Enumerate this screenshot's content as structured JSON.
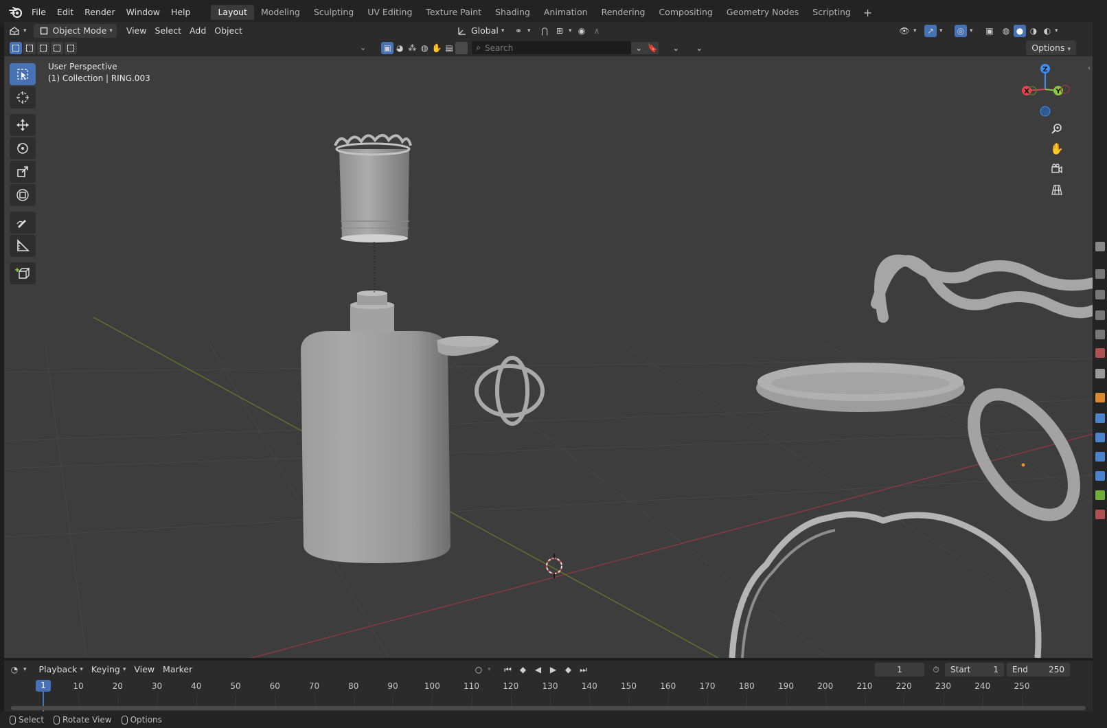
{
  "menu": {
    "items": [
      "File",
      "Edit",
      "Render",
      "Window",
      "Help"
    ]
  },
  "workspaces": {
    "tabs": [
      "Layout",
      "Modeling",
      "Sculpting",
      "UV Editing",
      "Texture Paint",
      "Shading",
      "Animation",
      "Rendering",
      "Compositing",
      "Geometry Nodes",
      "Scripting"
    ],
    "active": "Layout",
    "add_icon": "plus-icon"
  },
  "viewport_header": {
    "mode": "Object Mode",
    "menus": [
      "View",
      "Select",
      "Add",
      "Object"
    ],
    "transform_orientation": "Global"
  },
  "tool_settings": {
    "search_placeholder": "Search",
    "options_label": "Options"
  },
  "viewport": {
    "perspective": "User Perspective",
    "collection_info": "(1) Collection | RING.003",
    "gizmo_axes": [
      "X",
      "Y",
      "Z"
    ],
    "axis_colors": {
      "x": "#e8434f",
      "y": "#8cc63e",
      "z": "#3f8ef0"
    }
  },
  "toolbar": {
    "tools": [
      "select-box-icon",
      "cursor-icon",
      "move-icon",
      "rotate-icon",
      "scale-icon",
      "transform-icon",
      "annotate-icon",
      "measure-icon",
      "add-cube-icon"
    ]
  },
  "timeline": {
    "menus": [
      "Playback",
      "Keying",
      "View",
      "Marker"
    ],
    "current_frame": "1",
    "start_label": "Start",
    "start_value": "1",
    "end_label": "End",
    "end_value": "250",
    "ticks": [
      "10",
      "20",
      "30",
      "40",
      "50",
      "60",
      "70",
      "80",
      "90",
      "100",
      "110",
      "120",
      "130",
      "140",
      "150",
      "160",
      "170",
      "180",
      "190",
      "200",
      "210",
      "220",
      "230",
      "240",
      "250"
    ],
    "playhead_label": "1"
  },
  "statusbar": {
    "items": [
      "Select",
      "Rotate View",
      "Options"
    ]
  },
  "colors": {
    "accent": "#4772b3",
    "viewport_bg": "#3d3d3d"
  }
}
